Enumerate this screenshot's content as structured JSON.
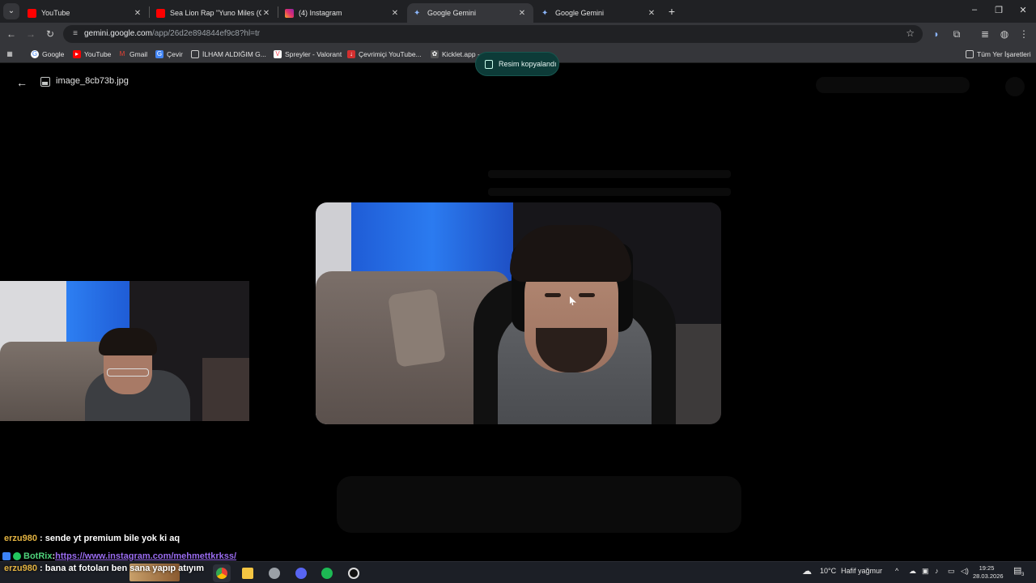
{
  "tabs": [
    {
      "title": "YouTube",
      "icon": "youtube-icon",
      "active": false
    },
    {
      "title": "Sea Lion Rap \"Yuno Miles (Offic",
      "icon": "youtube-icon",
      "active": false
    },
    {
      "title": "(4) Instagram",
      "icon": "instagram-icon",
      "active": false
    },
    {
      "title": "Google Gemini",
      "icon": "gemini-icon",
      "active": true
    },
    {
      "title": "Google Gemini",
      "icon": "gemini-icon",
      "active": false
    }
  ],
  "address_bar": {
    "host": "gemini.google.com",
    "path": "/app/26d2e894844ef9c8?hl=tr"
  },
  "bookmarks": [
    {
      "label": "Google",
      "icon": "google-icon"
    },
    {
      "label": "YouTube",
      "icon": "youtube-icon"
    },
    {
      "label": "Gmail",
      "icon": "gmail-icon"
    },
    {
      "label": "Çevir",
      "icon": "translate-icon"
    },
    {
      "label": "İLHAM ALDIĞIM G...",
      "icon": "folder-icon"
    },
    {
      "label": "Spreyler - Valorant",
      "icon": "valorant-icon"
    },
    {
      "label": "Çevrimiçi YouTube...",
      "icon": "converter-icon"
    },
    {
      "label": "Kicklet.app - ...",
      "icon": "kicklet-icon"
    }
  ],
  "all_bookmarks_label": "Tüm Yer İşaretleri",
  "toast": {
    "text": "Resim kopyalandı"
  },
  "viewer": {
    "filename": "image_8cb73b.jpg"
  },
  "chat": [
    {
      "user": "erzu980",
      "message": " : sende yt premium bile yok ki aq"
    },
    {
      "user": "BotRix",
      "message": " : ",
      "link": "https://www.instagram.com/mehmettkrkss/"
    },
    {
      "user": "erzu980",
      "message": " : bana at fotoları ben sana yapıp atıyım"
    }
  ],
  "taskbar": {
    "weather_temp": "10°C",
    "weather_desc": "Hafif yağmur",
    "time": "19:25",
    "date": "28.03.2026",
    "notification_count": "3"
  },
  "colors": {
    "toast_bg": "#0d3b38",
    "chrome_dark": "#202124",
    "chrome_toolbar": "#35363a",
    "username": "#e3b341",
    "link": "#9a6cf0"
  }
}
